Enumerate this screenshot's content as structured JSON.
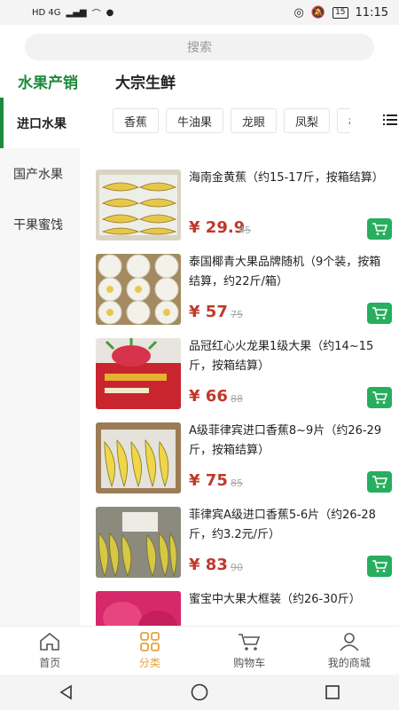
{
  "status_bar": {
    "network": "HD 4G",
    "battery": "15",
    "time": "11:15"
  },
  "search": {
    "placeholder": "搜索"
  },
  "category": {
    "left_title": "水果产销",
    "right_title": "大宗生鲜"
  },
  "sidebar": {
    "items": [
      {
        "label": "进口水果",
        "active": true
      },
      {
        "label": "国产水果",
        "active": false
      },
      {
        "label": "干果蜜饯",
        "active": false
      }
    ]
  },
  "chips": [
    "香蕉",
    "牛油果",
    "龙眼",
    "凤梨",
    "榴"
  ],
  "products": [
    {
      "name": "海南金黄蕉（约15-17斤，按箱结算）",
      "price": "¥ 29.9",
      "old_price": "45",
      "image": "bananas-in-box"
    },
    {
      "name": "泰国椰青大果品牌随机（9个装，按箱结算，约22斤/箱）",
      "price": "¥ 57",
      "old_price": "75",
      "image": "coconuts-in-box"
    },
    {
      "name": "品冠红心火龙果1级大果（约14~15斤，按箱结算）",
      "price": "¥ 66",
      "old_price": "88",
      "image": "dragon-fruit-box"
    },
    {
      "name": "A级菲律宾进口香蕉8~9片（约26-29斤，按箱结算）",
      "price": "¥ 75",
      "old_price": "85",
      "image": "bananas-in-box"
    },
    {
      "name": "菲律宾A级进口香蕉5-6片（约26-28斤，约3.2元/斤）",
      "price": "¥ 83",
      "old_price": "90",
      "image": "bananas-in-box"
    },
    {
      "name": "蜜宝中大果大框装（约26-30斤）",
      "price": "",
      "old_price": "",
      "image": "dragon-fruit-red"
    }
  ],
  "tabbar": {
    "items": [
      {
        "label": "首页",
        "icon": "home-icon",
        "active": false
      },
      {
        "label": "分类",
        "icon": "category-grid-icon",
        "active": true
      },
      {
        "label": "购物车",
        "icon": "cart-icon",
        "active": false
      },
      {
        "label": "我的商城",
        "icon": "user-icon",
        "active": false
      }
    ]
  },
  "colors": {
    "accent_green": "#1e8a3e",
    "price_red": "#c0392b",
    "cart_green": "#27ae5f",
    "tab_active": "#e6a23c"
  }
}
